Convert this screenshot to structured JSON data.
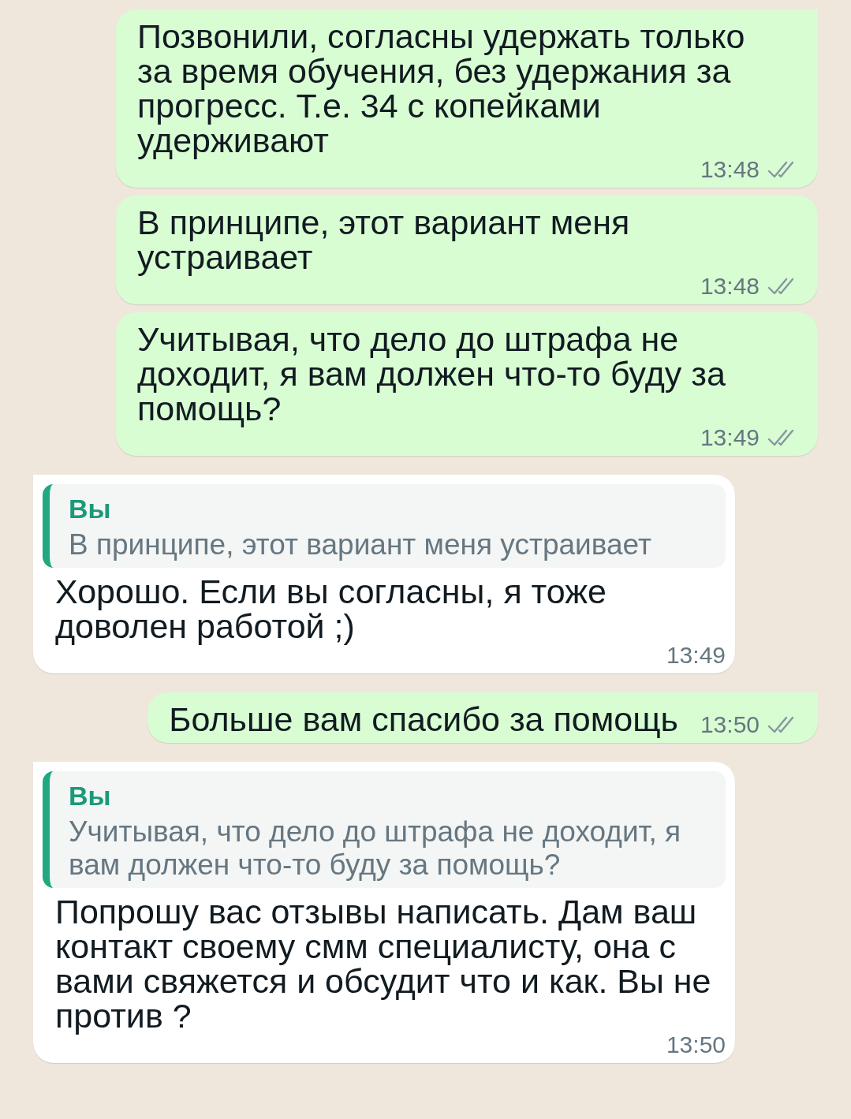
{
  "messages": [
    {
      "kind": "outgoing",
      "tail": true,
      "text": "Позвонили, согласны удержать только за время обучения, без удержания за прогресс. Т.е. 34 с копейками удерживают",
      "time": "13:48",
      "read": false
    },
    {
      "kind": "outgoing",
      "tail": false,
      "text": "В принципе, этот вариант меня устраивает",
      "time": "13:48",
      "read": false
    },
    {
      "kind": "outgoing",
      "tail": false,
      "text": "Учитывая, что дело до штрафа не доходит, я вам должен что-то буду за помощь?",
      "time": "13:49",
      "read": false
    },
    {
      "kind": "incoming",
      "tail": true,
      "quote": {
        "author": "Вы",
        "text": "В принципе, этот вариант меня устраивает"
      },
      "text": "Хорошо. Если вы согласны, я тоже доволен работой ;)",
      "time": "13:49"
    },
    {
      "kind": "outgoing",
      "tail": true,
      "text": "Больше вам спасибо за помощь",
      "time": "13:50",
      "read": false
    },
    {
      "kind": "incoming",
      "tail": true,
      "quote": {
        "author": "Вы",
        "text": "Учитывая, что дело до штрафа не доходит, я вам должен что-то буду за помощь?"
      },
      "text": "Попрошу вас отзывы написать. Дам ваш контакт своему смм специалисту, она с вами свяжется и обсудит что и как. Вы не против ?",
      "time": "13:50"
    }
  ]
}
